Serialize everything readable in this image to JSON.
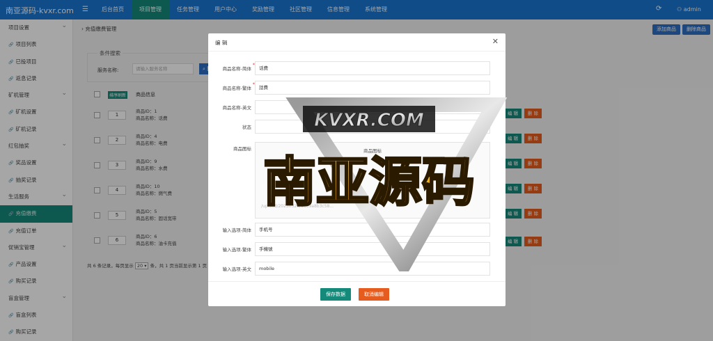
{
  "topbar": {
    "brand": "南亚源码-kvxr.com",
    "menu_icon": "hamburger-icon",
    "nav": [
      "后台首页",
      "项目管理",
      "任务管理",
      "用户中心",
      "奖励管理",
      "社区管理",
      "信息管理",
      "系统管理"
    ],
    "active_nav": "项目管理",
    "user": "admin"
  },
  "sidebar": {
    "items": [
      {
        "label": "项目设置",
        "type": "group"
      },
      {
        "label": "项目列表",
        "type": "sub"
      },
      {
        "label": "已投项目",
        "type": "sub"
      },
      {
        "label": "返息记录",
        "type": "sub"
      },
      {
        "label": "矿机管理",
        "type": "group"
      },
      {
        "label": "矿机设置",
        "type": "sub"
      },
      {
        "label": "矿机记录",
        "type": "sub"
      },
      {
        "label": "红包抽奖",
        "type": "group"
      },
      {
        "label": "奖品设置",
        "type": "sub"
      },
      {
        "label": "抽奖记录",
        "type": "sub"
      },
      {
        "label": "生活服务",
        "type": "group"
      },
      {
        "label": "充值缴费",
        "type": "sub",
        "active": true
      },
      {
        "label": "充值订单",
        "type": "sub"
      },
      {
        "label": "促销宝管理",
        "type": "group"
      },
      {
        "label": "产品设置",
        "type": "sub"
      },
      {
        "label": "购买记录",
        "type": "sub"
      },
      {
        "label": "盲盒管理",
        "type": "group"
      },
      {
        "label": "盲盒列表",
        "type": "sub"
      },
      {
        "label": "购买记录",
        "type": "sub"
      }
    ]
  },
  "main": {
    "breadcrumb": "充值缴费管理",
    "btn_add": "添加商品",
    "btn_delete": "删除商品",
    "search": {
      "legend": "条件搜索",
      "label": "服务名称:",
      "placeholder": "请输入服务名称",
      "button": "搜 索"
    },
    "table": {
      "sort_header": "排序刷新",
      "info_header": "商品信息",
      "rows": [
        {
          "sort": "1",
          "id": "商品ID：1",
          "name": "商品名称：话费"
        },
        {
          "sort": "2",
          "id": "商品ID：4",
          "name": "商品名称：电费"
        },
        {
          "sort": "3",
          "id": "商品ID：9",
          "name": "商品名称：水费"
        },
        {
          "sort": "4",
          "id": "商品ID：10",
          "name": "商品名称：燃气费"
        },
        {
          "sort": "5",
          "id": "商品ID：5",
          "name": "商品名称：固话宽带"
        },
        {
          "sort": "6",
          "id": "商品ID：6",
          "name": "商品名称：油卡充值"
        }
      ],
      "edit_label": "编 辑",
      "delete_label": "删 除"
    },
    "pager": {
      "prefix": "共 6 条记录，每页显示",
      "per_page": "20",
      "suffix": "条，共 1 页当前显示第 1 页"
    }
  },
  "modal": {
    "title": "编 辑",
    "fields": [
      {
        "label": "商品名称-简体",
        "value": "话费",
        "required": true
      },
      {
        "label": "商品名称-繁体",
        "value": "話費",
        "required": true
      },
      {
        "label": "商品名称-英文",
        "value": ""
      },
      {
        "label": "状态",
        "value": ""
      }
    ],
    "image_label": "商品图标",
    "image_title": "商品图标",
    "image_url": "/upload/20230320/1d69a8b3c58...",
    "fields2": [
      {
        "label": "输入选项-简体",
        "value": "手机号"
      },
      {
        "label": "输入选项-繁体",
        "value": "手機號"
      },
      {
        "label": "输入选项-英文",
        "value": "mobile"
      }
    ],
    "save": "保存数据",
    "cancel": "取消编辑"
  },
  "watermark": {
    "top_text": "KVXR.COM",
    "main_text": "南亚源码"
  },
  "colors": {
    "topbar": "#1976d2",
    "accent": "#15897a",
    "danger": "#e65c1e",
    "primary": "#2d6fc4"
  }
}
